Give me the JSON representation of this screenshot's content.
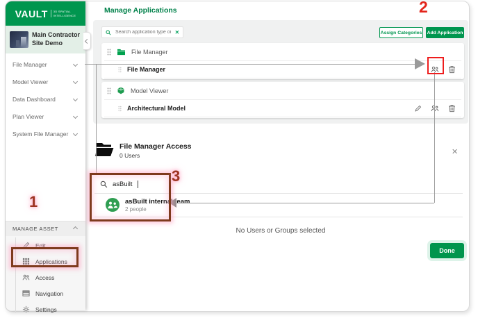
{
  "colors": {
    "brand_green": "#00964F",
    "light_green_bg": "#E3EFE7",
    "panel_gray": "#F0F1F1",
    "annotation_bright_red": "#E3251B",
    "annotation_maroon": "#9E3523",
    "annotation_box_maroon": "#7E3A1D",
    "annotation_line_gray": "#9B9B9B"
  },
  "sidebar": {
    "logo": "VAULT",
    "tagline1": "3D SPATIAL",
    "tagline2": "INTELLIGENCE",
    "site_line1": "Main Contractor",
    "site_line2": "Site Demo",
    "nav": [
      {
        "label": "File Manager"
      },
      {
        "label": "Model Viewer"
      },
      {
        "label": "Data Dashboard"
      },
      {
        "label": "Plan Viewer"
      },
      {
        "label": "System File Manager"
      }
    ],
    "manage_asset": {
      "header": "MANAGE ASSET",
      "items": [
        {
          "label": "Edit",
          "icon": "pencil-icon"
        },
        {
          "label": "Applications",
          "icon": "grid-icon"
        },
        {
          "label": "Access",
          "icon": "people-icon"
        },
        {
          "label": "Navigation",
          "icon": "table-icon"
        },
        {
          "label": "Settings",
          "icon": "gear-icon"
        }
      ]
    }
  },
  "header": {
    "title": "Manage Applications"
  },
  "toolbar": {
    "search_placeholder": "Search application type or name ...",
    "clear_glyph": "✕",
    "assign_categories": "Assign Categories",
    "add_application": "Add Application"
  },
  "apps": {
    "groups": [
      {
        "name": "File Manager",
        "icon": "folder-icon",
        "item": "File Manager",
        "actions": [
          "access-users-icon",
          "trash-icon"
        ]
      },
      {
        "name": "Model Viewer",
        "icon": "cube-icon",
        "item": "Architectural Model",
        "actions": [
          "edit-pencil-icon",
          "access-users-icon",
          "trash-icon"
        ]
      }
    ]
  },
  "modal": {
    "title": "File Manager Access",
    "subtitle": "0 Users",
    "close_glyph": "✕",
    "search_value": "asBuilt",
    "team_name": "asBuilt internal team",
    "team_sub": "2 people",
    "empty": "No Users or Groups selected",
    "done": "Done"
  },
  "annotations": {
    "n1": "1",
    "n2": "2",
    "n3": "3"
  }
}
